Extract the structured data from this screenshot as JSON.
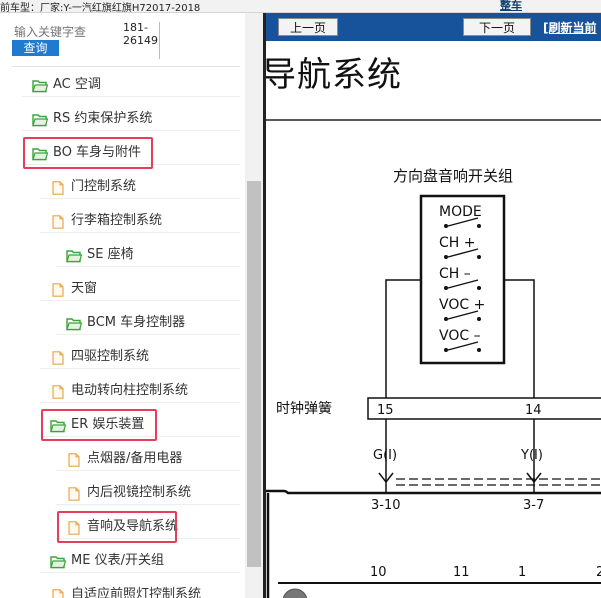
{
  "topbar": {
    "car_info": "前车型：厂家:Y-一汽红旗红旗H72017-2018",
    "link_label": "整车"
  },
  "search": {
    "placeholder": "输入关键字查",
    "button_label": "查询",
    "result_code": "181-\n26149"
  },
  "tree": {
    "items": [
      {
        "label": "AC 空调",
        "icon": "folder-open-icon",
        "level": 1
      },
      {
        "label": "RS 约束保护系统",
        "icon": "folder-open-icon",
        "level": 1
      },
      {
        "label": "BO 车身与附件",
        "icon": "folder-open-icon",
        "level": 1,
        "highlighted": true
      },
      {
        "label": "门控制系统",
        "icon": "document-icon",
        "level": 2
      },
      {
        "label": "行李箱控制系统",
        "icon": "document-icon",
        "level": 2
      },
      {
        "label": "SE 座椅",
        "icon": "folder-open-icon",
        "level": 3
      },
      {
        "label": "天窗",
        "icon": "document-icon",
        "level": 2
      },
      {
        "label": "BCM 车身控制器",
        "icon": "folder-open-icon",
        "level": 3
      },
      {
        "label": "四驱控制系统",
        "icon": "document-icon",
        "level": 2
      },
      {
        "label": "电动转向柱控制系统",
        "icon": "document-icon",
        "level": 2
      },
      {
        "label": "ER 娱乐装置",
        "icon": "folder-open-icon",
        "level": 2,
        "highlighted": true
      },
      {
        "label": "点烟器/备用电器",
        "icon": "document-icon",
        "level": 3
      },
      {
        "label": "内后视镜控制系统",
        "icon": "document-icon",
        "level": 3
      },
      {
        "label": "音响及导航系统",
        "icon": "document-icon",
        "level": 3,
        "highlighted": true
      },
      {
        "label": "ME 仪表/开关组",
        "icon": "folder-open-icon",
        "level": 2
      },
      {
        "label": "自适应前照灯控制系统",
        "icon": "document-icon",
        "level": 2
      }
    ]
  },
  "doc": {
    "prev_label": "上一页",
    "next_label": "下一页",
    "refresh_label": "[刷新当前",
    "title": "导航系统",
    "diagram": {
      "component_title": "方向盘音响开关组",
      "switches": [
        "MODE",
        "CH +",
        "CH –",
        "VOC +",
        "VOC –"
      ],
      "clock_spring_label": "时钟弹簧",
      "pins": [
        "15",
        "14"
      ],
      "wire_colors": [
        "G(I)",
        "Y(I)"
      ],
      "connectors": [
        "3-10",
        "3-7"
      ],
      "bottom_pins": [
        "10",
        "11",
        "1",
        "2"
      ]
    }
  },
  "colors": {
    "toolbar": "#16539b",
    "search_button": "#1f7bcf",
    "highlight": "#e53d5a",
    "folder_green": "#3aa33a",
    "doc_orange": "#e8a64a"
  }
}
